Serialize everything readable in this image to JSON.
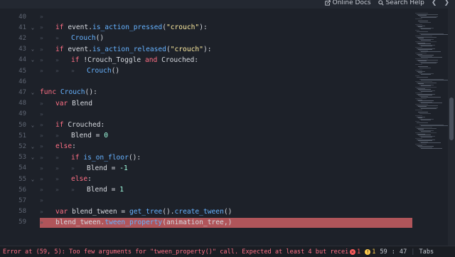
{
  "topbar": {
    "online_docs": "Online Docs",
    "search_help": "Search Help",
    "prev": "❮",
    "next": "❯"
  },
  "lines": [
    {
      "n": "40",
      "fold": false,
      "indent": 1,
      "tokens": []
    },
    {
      "n": "41",
      "fold": true,
      "indent": 1,
      "tokens": [
        [
          "kw",
          "if "
        ],
        [
          "plain",
          "event."
        ],
        [
          "fn",
          "is_action_pressed"
        ],
        [
          "plain",
          "("
        ],
        [
          "str",
          "\"crouch\""
        ],
        [
          "plain",
          "):"
        ]
      ]
    },
    {
      "n": "42",
      "fold": false,
      "indent": 2,
      "tokens": [
        [
          "fn",
          "Crouch"
        ],
        [
          "plain",
          "()"
        ]
      ]
    },
    {
      "n": "43",
      "fold": true,
      "indent": 1,
      "tokens": [
        [
          "kw",
          "if "
        ],
        [
          "plain",
          "event."
        ],
        [
          "fn",
          "is_action_released"
        ],
        [
          "plain",
          "("
        ],
        [
          "str",
          "\"crouch\""
        ],
        [
          "plain",
          "):"
        ]
      ]
    },
    {
      "n": "44",
      "fold": true,
      "indent": 2,
      "tokens": [
        [
          "kw",
          "if "
        ],
        [
          "plain",
          "!Crouch_Toggle "
        ],
        [
          "kw",
          "and "
        ],
        [
          "plain",
          "Crouched:"
        ]
      ]
    },
    {
      "n": "45",
      "fold": false,
      "indent": 3,
      "tokens": [
        [
          "fn",
          "Crouch"
        ],
        [
          "plain",
          "()"
        ]
      ]
    },
    {
      "n": "46",
      "fold": false,
      "indent": 0,
      "tokens": []
    },
    {
      "n": "47",
      "fold": true,
      "indent": 0,
      "tokens": [
        [
          "kw",
          "func "
        ],
        [
          "fn",
          "Crouch"
        ],
        [
          "plain",
          "():"
        ]
      ]
    },
    {
      "n": "48",
      "fold": false,
      "indent": 1,
      "tokens": [
        [
          "kw",
          "var "
        ],
        [
          "plain",
          "Blend"
        ]
      ]
    },
    {
      "n": "49",
      "fold": false,
      "indent": 1,
      "tokens": []
    },
    {
      "n": "50",
      "fold": true,
      "indent": 1,
      "tokens": [
        [
          "kw",
          "if "
        ],
        [
          "plain",
          "Crouched:"
        ]
      ]
    },
    {
      "n": "51",
      "fold": false,
      "indent": 2,
      "tokens": [
        [
          "plain",
          "Blend = "
        ],
        [
          "num",
          "0"
        ]
      ]
    },
    {
      "n": "52",
      "fold": true,
      "indent": 1,
      "tokens": [
        [
          "kw",
          "else"
        ],
        [
          "plain",
          ":"
        ]
      ]
    },
    {
      "n": "53",
      "fold": true,
      "indent": 2,
      "tokens": [
        [
          "kw",
          "if "
        ],
        [
          "fn",
          "is_on_floor"
        ],
        [
          "plain",
          "():"
        ]
      ]
    },
    {
      "n": "54",
      "fold": false,
      "indent": 3,
      "tokens": [
        [
          "plain",
          "Blend = "
        ],
        [
          "num",
          "-1"
        ]
      ]
    },
    {
      "n": "55",
      "fold": true,
      "indent": 2,
      "tokens": [
        [
          "kw",
          "else"
        ],
        [
          "plain",
          ":"
        ]
      ]
    },
    {
      "n": "56",
      "fold": false,
      "indent": 3,
      "tokens": [
        [
          "plain",
          "Blend = "
        ],
        [
          "num",
          "1"
        ]
      ]
    },
    {
      "n": "57",
      "fold": false,
      "indent": 1,
      "tokens": []
    },
    {
      "n": "58",
      "fold": false,
      "indent": 1,
      "tokens": [
        [
          "kw",
          "var "
        ],
        [
          "plain",
          "blend_tween = "
        ],
        [
          "fn",
          "get_tree"
        ],
        [
          "plain",
          "()."
        ],
        [
          "fn",
          "create_tween"
        ],
        [
          "plain",
          "()"
        ]
      ]
    },
    {
      "n": "59",
      "fold": false,
      "indent": 1,
      "highlight": true,
      "tokens": [
        [
          "plain",
          "blend_tween."
        ],
        [
          "fn",
          "tween_property"
        ],
        [
          "plain",
          "(animation_tree,)"
        ]
      ]
    }
  ],
  "status": {
    "error": "Error at (59, 5): Too few arguments for \"tween_property()\" call. Expected at least 4 but recei",
    "errors": "1",
    "warnings": "1",
    "line": "59",
    "col": "47",
    "indent": "Tabs"
  },
  "colors": {
    "error_highlight": "#b0555a",
    "keyword": "#ff7085",
    "function": "#66b2ff",
    "string": "#ffeda1",
    "number": "#a1ffe0"
  }
}
